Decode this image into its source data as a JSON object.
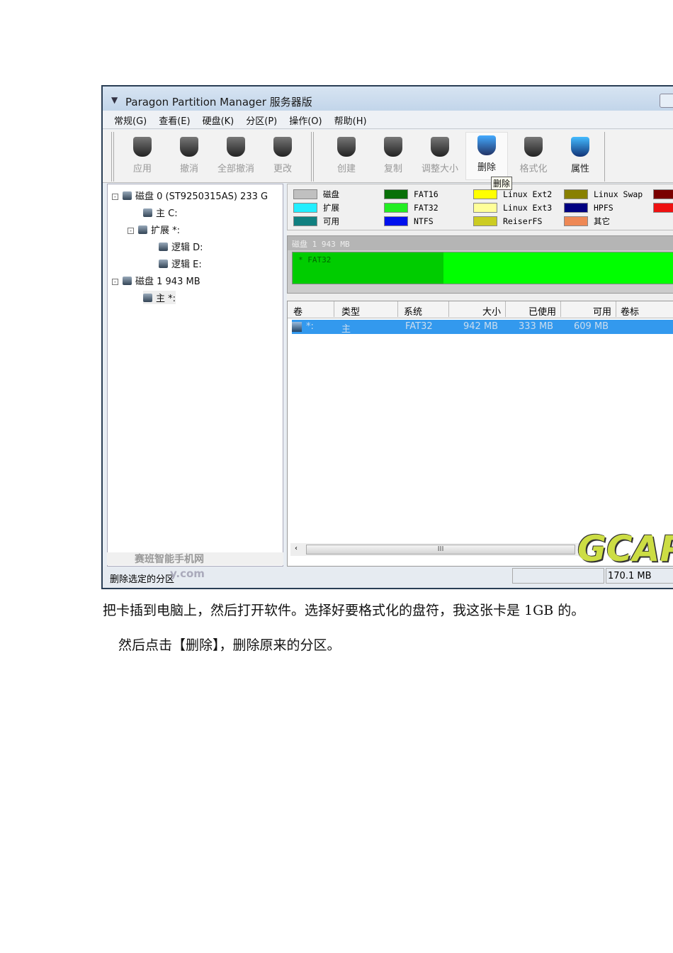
{
  "window": {
    "title": "Paragon Partition Manager 服务器版"
  },
  "menu": [
    "常规(G)",
    "查看(E)",
    "硬盘(K)",
    "分区(P)",
    "操作(O)",
    "帮助(H)"
  ],
  "toolbar": [
    {
      "label": "应用",
      "enabled": false
    },
    {
      "label": "撤消",
      "enabled": false
    },
    {
      "label": "全部撤消",
      "enabled": false
    },
    {
      "label": "更改",
      "enabled": false
    },
    {
      "label": "创建",
      "enabled": false
    },
    {
      "label": "复制",
      "enabled": false
    },
    {
      "label": "调整大小",
      "enabled": false
    },
    {
      "label": "删除",
      "enabled": true
    },
    {
      "label": "格式化",
      "enabled": false
    },
    {
      "label": "属性",
      "enabled": true
    }
  ],
  "tooltip": "删除",
  "tree": [
    "磁盘 0 (ST9250315AS) 233 G",
    "主 C:",
    "扩展 *:",
    "逻辑 D:",
    "逻辑 E:",
    "磁盘 1 943 MB",
    "主 *:"
  ],
  "legend": [
    {
      "label": "磁盘",
      "color": "#c0c0c0"
    },
    {
      "label": "扩展",
      "color": "#22eeff"
    },
    {
      "label": "可用",
      "color": "#118080"
    },
    {
      "label": "FAT16",
      "color": "#087008"
    },
    {
      "label": "FAT32",
      "color": "#22ee22"
    },
    {
      "label": "NTFS",
      "color": "#0010ee"
    },
    {
      "label": "Linux Ext2",
      "color": "#ffff00"
    },
    {
      "label": "Linux Ext3",
      "color": "#ffff99"
    },
    {
      "label": "ReiserFS",
      "color": "#cccc22"
    },
    {
      "label": "Linux Swap",
      "color": "#888000"
    },
    {
      "label": "HPFS",
      "color": "#000080"
    },
    {
      "label": "其它",
      "color": "#ee8855"
    }
  ],
  "diskmap": {
    "header": "磁盘 1 943 MB",
    "partition": "*  FAT32"
  },
  "table": {
    "headers": [
      "卷",
      "类型",
      "系统",
      "大小",
      "已使用",
      "可用",
      "卷标"
    ],
    "rows": [
      [
        "*:",
        "主",
        "FAT32",
        "942 MB",
        "333 MB",
        "609 MB",
        ""
      ]
    ]
  },
  "status": {
    "text": "删除选定的分区",
    "size": "170.1 MB"
  },
  "watermark": {
    "site": "赛班智能手机网",
    "domain": "y.com",
    "logo": "GCAP"
  },
  "doc": {
    "line1": "把卡插到电脑上，然后打开软件。选择好要格式化的盘符，我这张卡是 1GB 的。",
    "line2": "然后点击【删除】，删除原来的分区。"
  }
}
